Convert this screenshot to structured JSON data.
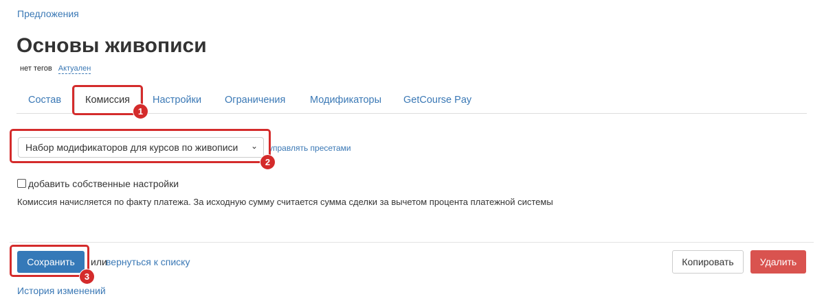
{
  "breadcrumb": "Предложения",
  "page_title": "Основы живописи",
  "meta": {
    "tags": "нет тегов",
    "status": "Актуален"
  },
  "tabs": [
    {
      "label": "Состав",
      "active": false
    },
    {
      "label": "Комиссия",
      "active": true
    },
    {
      "label": "Настройки",
      "active": false
    },
    {
      "label": "Ограничения",
      "active": false
    },
    {
      "label": "Модификаторы",
      "active": false
    },
    {
      "label": "GetCourse Pay",
      "active": false
    }
  ],
  "preset_select": {
    "selected": "Набор модификаторов для курсов по живописи",
    "icon": "chevron-down-icon"
  },
  "manage_presets_link": "управлять пресетами",
  "custom_settings": {
    "label": "добавить собственные настройки",
    "checked": false
  },
  "commission_note": "Комиссия начисляется по факту платежа. За исходную сумму считается сумма сделки за вычетом процента платежной системы",
  "actions": {
    "save": "Сохранить",
    "or": "или",
    "back_link": "вернуться к списку",
    "copy": "Копировать",
    "delete": "Удалить"
  },
  "history_link": "История изменений",
  "annotations": {
    "badge1": "1",
    "badge2": "2",
    "badge3": "3",
    "color": "#d42b2b"
  }
}
